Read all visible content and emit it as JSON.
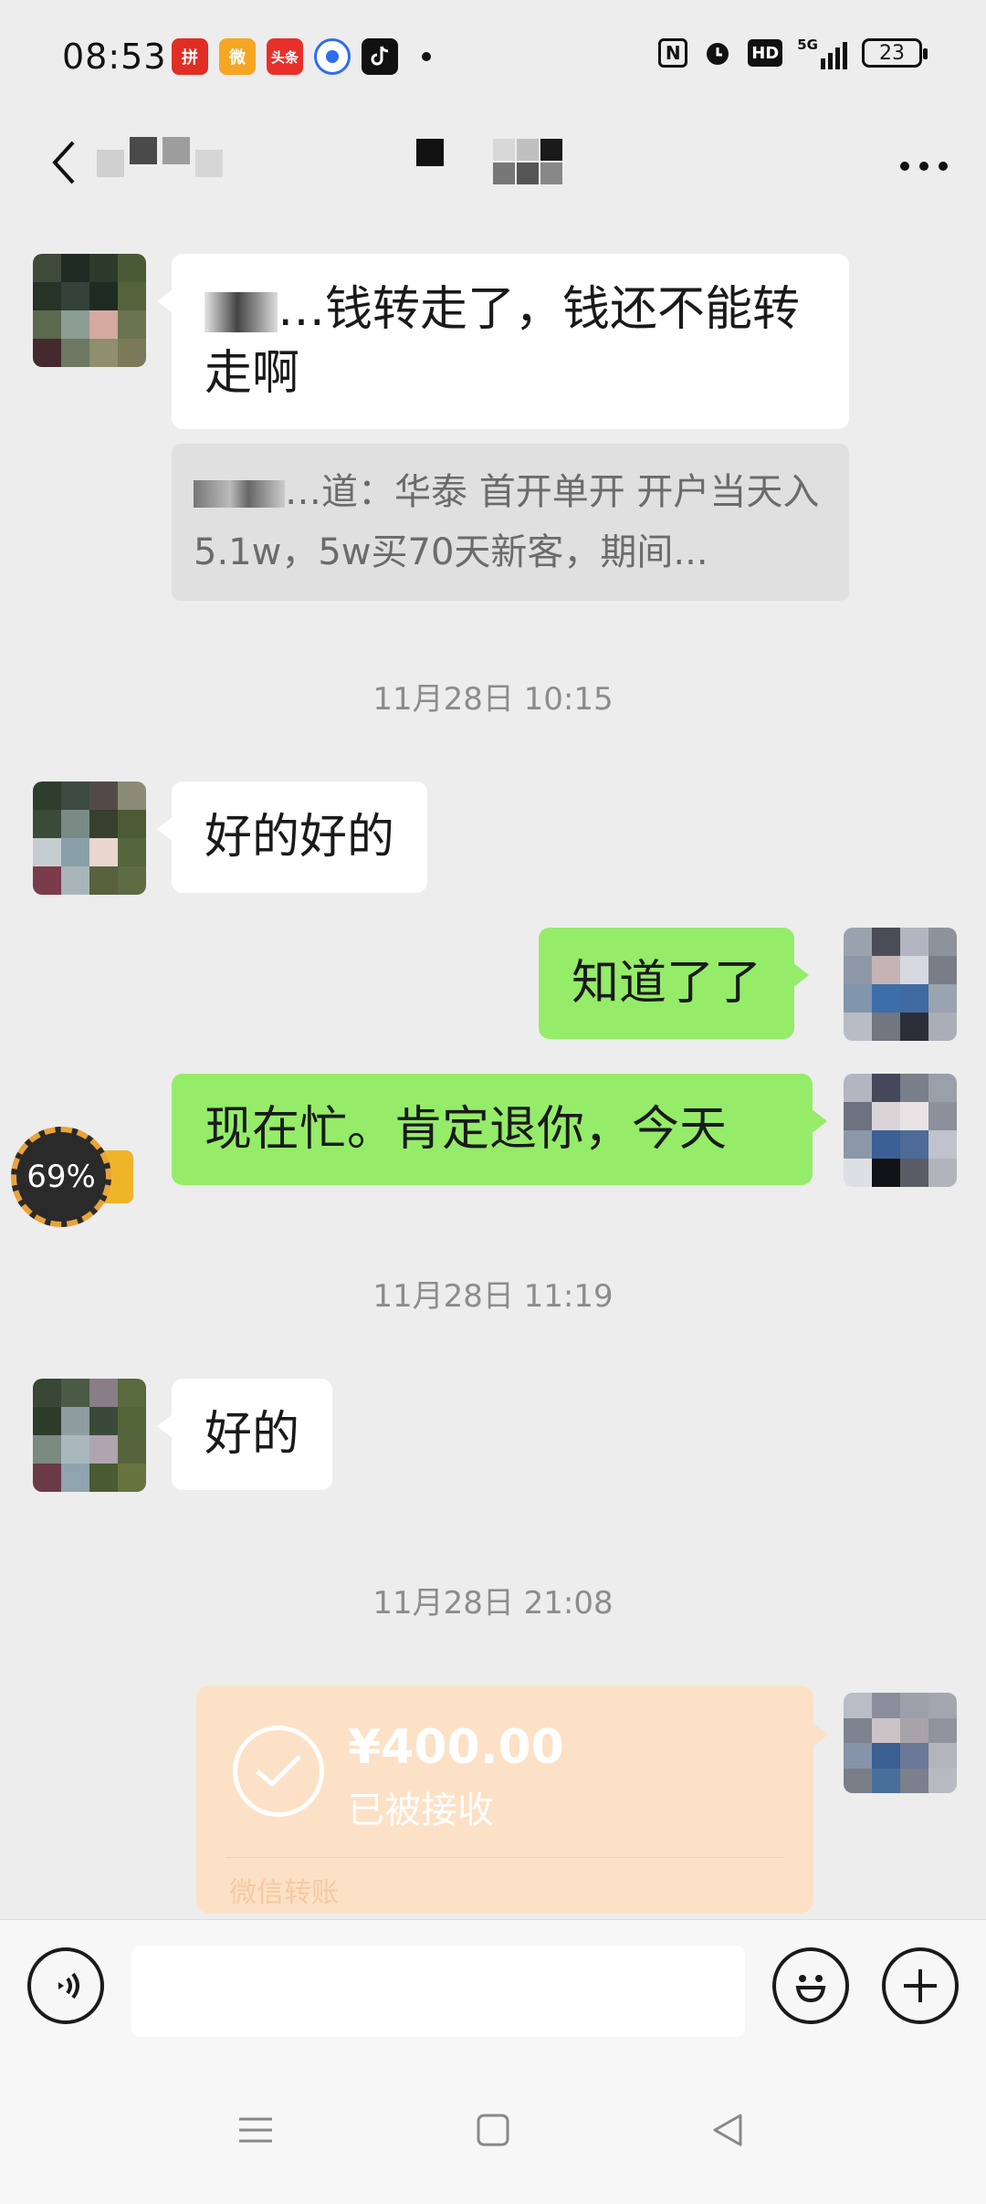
{
  "status_bar": {
    "time": "08:53",
    "notification_apps": [
      {
        "name": "pinduoduo-icon",
        "label": "拼",
        "color": "#e02e24"
      },
      {
        "name": "weibo-icon",
        "label": "微",
        "color": "#f5a623"
      },
      {
        "name": "toutiao-icon",
        "label": "头条",
        "color": "#e8302b"
      },
      {
        "name": "browser-icon",
        "label": "",
        "color": "#2f6df0"
      },
      {
        "name": "tiktok-icon",
        "label": "",
        "color": "#111111"
      }
    ],
    "battery": "23",
    "signal": "5G",
    "hd": "HD",
    "nfc": "N"
  },
  "header": {
    "title": ""
  },
  "messages": [
    {
      "side": "left",
      "text": "…钱转走了，钱还不能转走啊"
    },
    {
      "side": "left",
      "type": "quote",
      "text": "…道：华泰 首开单开 开户当天入5.1w，5w买70天新客，期间..."
    },
    {
      "type": "timestamp",
      "text": "11月28日 10:15"
    },
    {
      "side": "left",
      "text": "好的好的"
    },
    {
      "side": "right",
      "text": "知道了了"
    },
    {
      "side": "right",
      "text": "现在忙。肯定退你，今天"
    },
    {
      "type": "timestamp",
      "text": "11月28日 11:19"
    },
    {
      "side": "left",
      "text": "好的"
    },
    {
      "type": "timestamp",
      "text": "11月28日 21:08"
    }
  ],
  "transfer": {
    "amount": "¥400.00",
    "status": "已被接收",
    "footer": "微信转账"
  },
  "floating_widget": {
    "percent": "69%"
  },
  "colors": {
    "background": "#ededed",
    "self_bubble": "#95ec69",
    "other_bubble": "#ffffff",
    "transfer_card": "#fde1c6"
  }
}
